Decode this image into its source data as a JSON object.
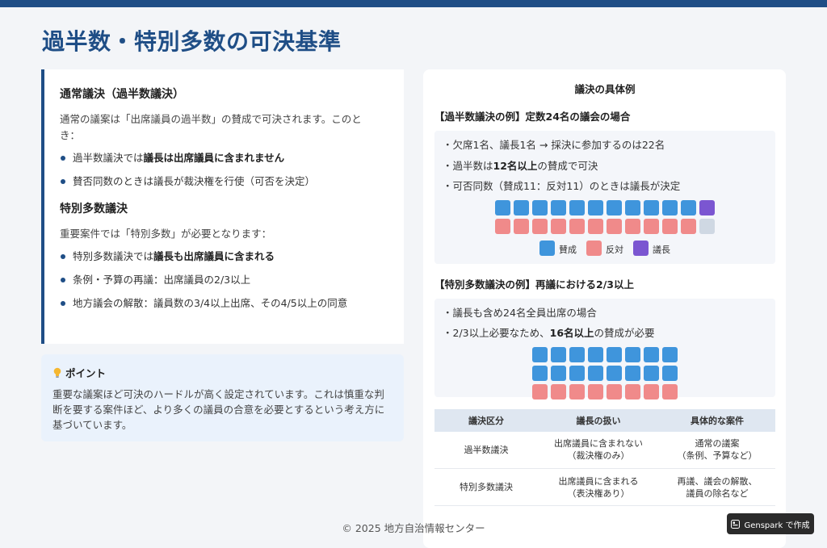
{
  "page": {
    "title": "過半数・特別多数の可決基準"
  },
  "colors": {
    "accent": "#1f4e86",
    "for": "#3f95dc",
    "against": "#f08a8a",
    "chair": "#7b56d1",
    "absent": "#cfd8e3"
  },
  "left": {
    "section1": {
      "title": "通常議決（過半数議決）",
      "desc": "通常の議案は「出席議員の過半数」の賛成で可決されます。このとき：",
      "items": [
        {
          "pre": "過半数議決では",
          "bold": "議長は出席議員に含まれません",
          "post": ""
        },
        {
          "pre": "賛否同数のときは議長が裁決権を行使（可否を決定）",
          "bold": "",
          "post": ""
        }
      ]
    },
    "section2": {
      "title": "特別多数議決",
      "desc": "重要案件では「特別多数」が必要となります：",
      "items": [
        {
          "pre": "特別多数議決では",
          "bold": "議長も出席議員に含まれる",
          "post": ""
        },
        {
          "pre": "条例・予算の再議：出席議員の2/3以上",
          "bold": "",
          "post": ""
        },
        {
          "pre": "地方議会の解散：議員数の3/4以上出席、その4/5以上の同意",
          "bold": "",
          "post": ""
        }
      ]
    }
  },
  "point": {
    "icon": "lightbulb-icon",
    "title": "ポイント",
    "text": "重要な議案ほど可決のハードルが高く設定されています。これは慎重な判断を要する案件ほど、より多くの議員の合意を必要とするという考え方に基づいています。"
  },
  "examples": {
    "title": "議決の具体例",
    "majority": {
      "heading": "【過半数議決の例】定数24名の議会の場合",
      "lines": [
        {
          "pre": "・欠席1名、議長1名 → 採決に参加するのは22名",
          "bold": "",
          "post": ""
        },
        {
          "pre": "・過半数は",
          "bold": "12名以上",
          "post": "の賛成で可決"
        },
        {
          "pre": "・可否同数（賛成11：反対11）のときは議長が決定",
          "bold": "",
          "post": ""
        }
      ],
      "grid": {
        "columns": 12,
        "seats": [
          "for",
          "for",
          "for",
          "for",
          "for",
          "for",
          "for",
          "for",
          "for",
          "for",
          "for",
          "chair",
          "against",
          "against",
          "against",
          "against",
          "against",
          "against",
          "against",
          "against",
          "against",
          "against",
          "against",
          "absent"
        ]
      },
      "legend": [
        {
          "key": "for",
          "label": "賛成"
        },
        {
          "key": "against",
          "label": "反対"
        },
        {
          "key": "chair",
          "label": "議長"
        }
      ]
    },
    "special": {
      "heading": "【特別多数議決の例】再議における2/3以上",
      "lines": [
        {
          "pre": "・議長も含め24名全員出席の場合",
          "bold": "",
          "post": ""
        },
        {
          "pre": "・2/3以上必要なため、",
          "bold": "16名以上",
          "post": "の賛成が必要"
        }
      ],
      "grid": {
        "columns": 8,
        "seats": [
          "for",
          "for",
          "for",
          "for",
          "for",
          "for",
          "for",
          "for",
          "for",
          "for",
          "for",
          "for",
          "for",
          "for",
          "for",
          "for",
          "against",
          "against",
          "against",
          "against",
          "against",
          "against",
          "against",
          "against"
        ]
      }
    },
    "table": {
      "headers": [
        "議決区分",
        "議長の扱い",
        "具体的な案件"
      ],
      "rows": [
        [
          "過半数議決",
          "出席議員に含まれない\n（裁決権のみ）",
          "通常の議案\n（条例、予算など）"
        ],
        [
          "特別多数議決",
          "出席議員に含まれる\n（表決権あり）",
          "再議、議会の解散、\n議員の除名など"
        ]
      ]
    }
  },
  "footer": {
    "text": "© 2025 地方自治情報センター"
  },
  "badge": {
    "icon": "genspark-logo-icon",
    "label": "Genspark で作成"
  }
}
